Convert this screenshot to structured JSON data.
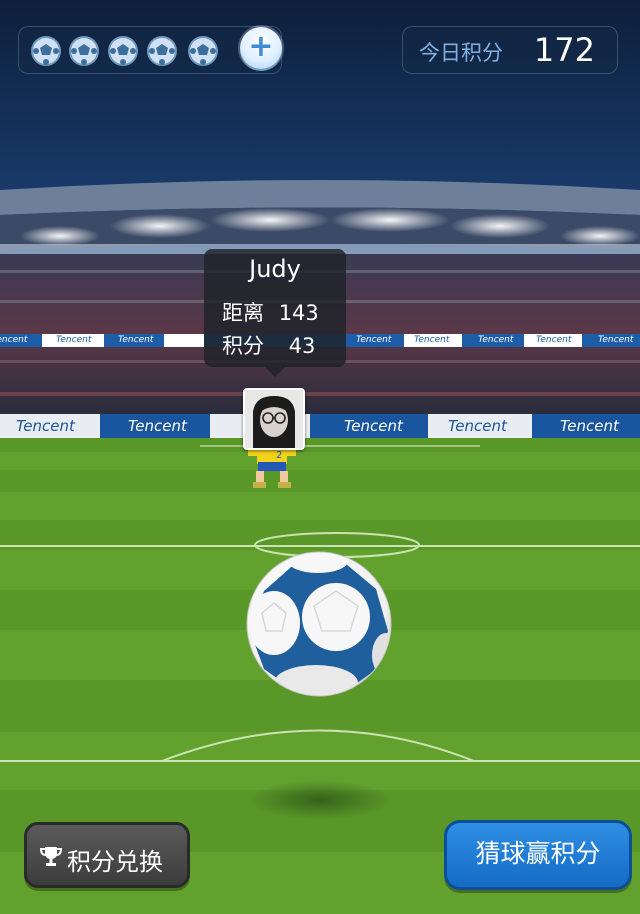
{
  "status": {
    "life_balls": [
      "ball-icon",
      "ball-icon",
      "ball-icon",
      "ball-icon",
      "ball-icon"
    ],
    "add_label": "+",
    "score_label": "今日积分",
    "score_value": "172"
  },
  "stadium": {
    "board_text": "Tencent"
  },
  "player": {
    "name": "Judy",
    "distance_label": "距离",
    "distance_value": "143",
    "points_label": "积分",
    "points_value": "43",
    "jersey_number": "2"
  },
  "buttons": {
    "exchange_label": "积分兑换",
    "guess_label": "猜球赢积分"
  },
  "colors": {
    "sky": "#0e2240",
    "grass_light": "#6aa832",
    "grass_dark": "#5a9629",
    "ball_blue": "#1f5f9e",
    "guess_button": "#1f7fd8"
  }
}
